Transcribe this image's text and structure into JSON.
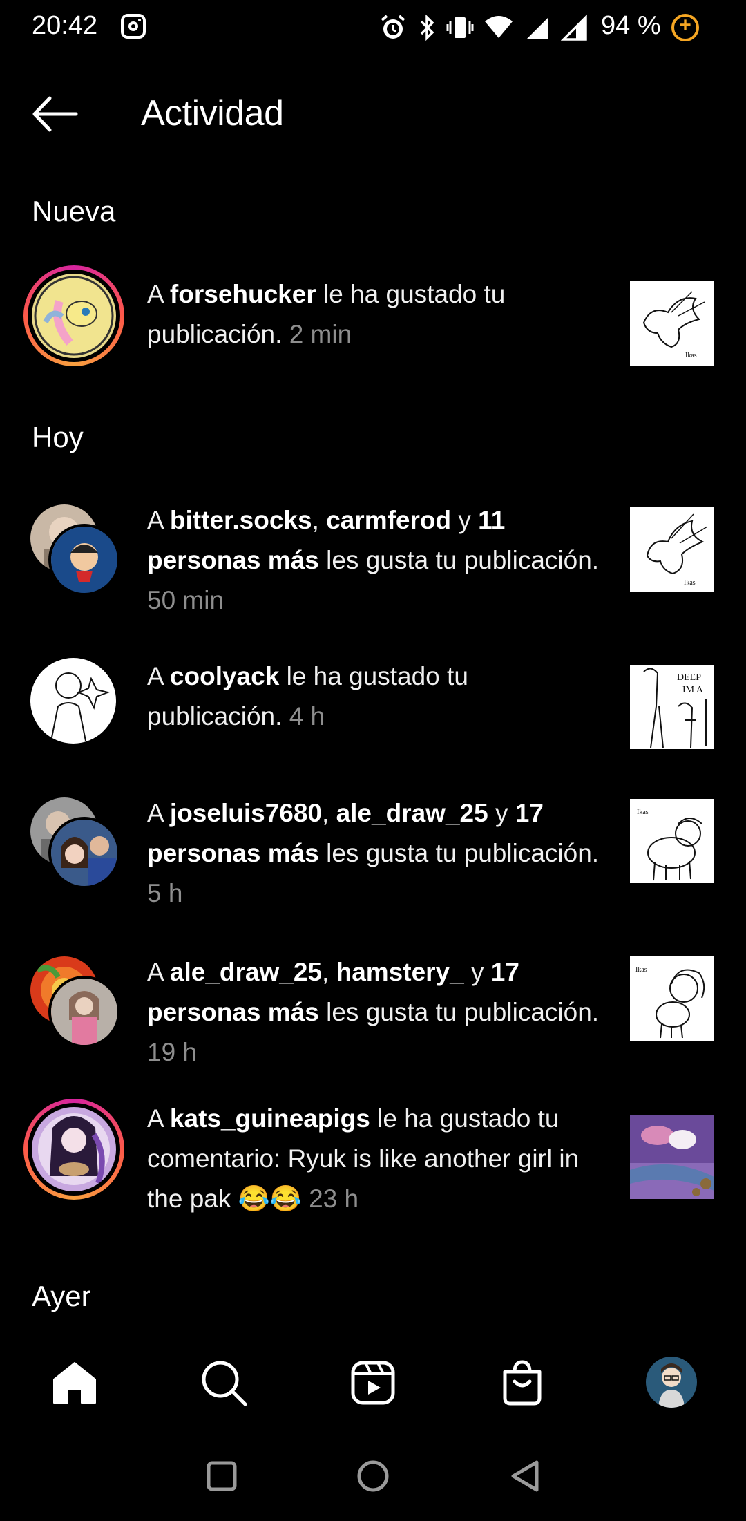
{
  "status_bar": {
    "time": "20:42",
    "battery": "94 %",
    "icons": [
      "instagram-icon",
      "alarm-icon",
      "bluetooth-icon",
      "vibrate-icon",
      "wifi-icon",
      "signal-icon",
      "signal-icon",
      "battery-saver-icon"
    ]
  },
  "header": {
    "title": "Actividad",
    "back_icon": "arrow-left-icon"
  },
  "sections": {
    "new": "Nueva",
    "today": "Hoy",
    "yesterday": "Ayer"
  },
  "notifications": [
    {
      "prefix": "A ",
      "user1": "forsehucker",
      "rest1": " le ha gustado tu publicación.",
      "time": "2 min"
    },
    {
      "prefix": "A ",
      "user1": "bitter.socks",
      "sep": ", ",
      "user2": "carmferod",
      "and": " y ",
      "others": "11 personas más",
      "rest": " les gusta tu publicación.",
      "time": "50 min"
    },
    {
      "prefix": "A ",
      "user1": "coolyack",
      "rest1": " le ha gustado tu publicación.",
      "time": "4 h"
    },
    {
      "prefix": "A ",
      "user1": "joseluis7680",
      "sep": ", ",
      "user2": "ale_draw_25",
      "and": " y ",
      "others": "17 personas más",
      "rest": " les gusta tu publicación.",
      "time": "5 h"
    },
    {
      "prefix": "A ",
      "user1": "ale_draw_25",
      "sep": ", ",
      "user2": "hamstery_",
      "and": " y ",
      "others": "17 personas más",
      "rest": " les gusta tu publicación.",
      "time": "19 h"
    },
    {
      "prefix": "A ",
      "user1": "kats_guineapigs",
      "rest1": " le ha gustado tu comentario: Ryuk is like another girl in the pak 😂😂",
      "time": "23 h"
    }
  ],
  "bottom_nav": {
    "items": [
      "home-icon",
      "search-icon",
      "reels-icon",
      "shop-icon",
      "profile-avatar"
    ]
  },
  "system_nav": {
    "items": [
      "recents-button",
      "home-button",
      "back-button"
    ]
  },
  "colors": {
    "background": "#000000",
    "text": "#f5f5f5",
    "muted": "#8e8e8e",
    "story_ring_start": "#d6249f",
    "story_ring_end": "#f9a03f"
  }
}
